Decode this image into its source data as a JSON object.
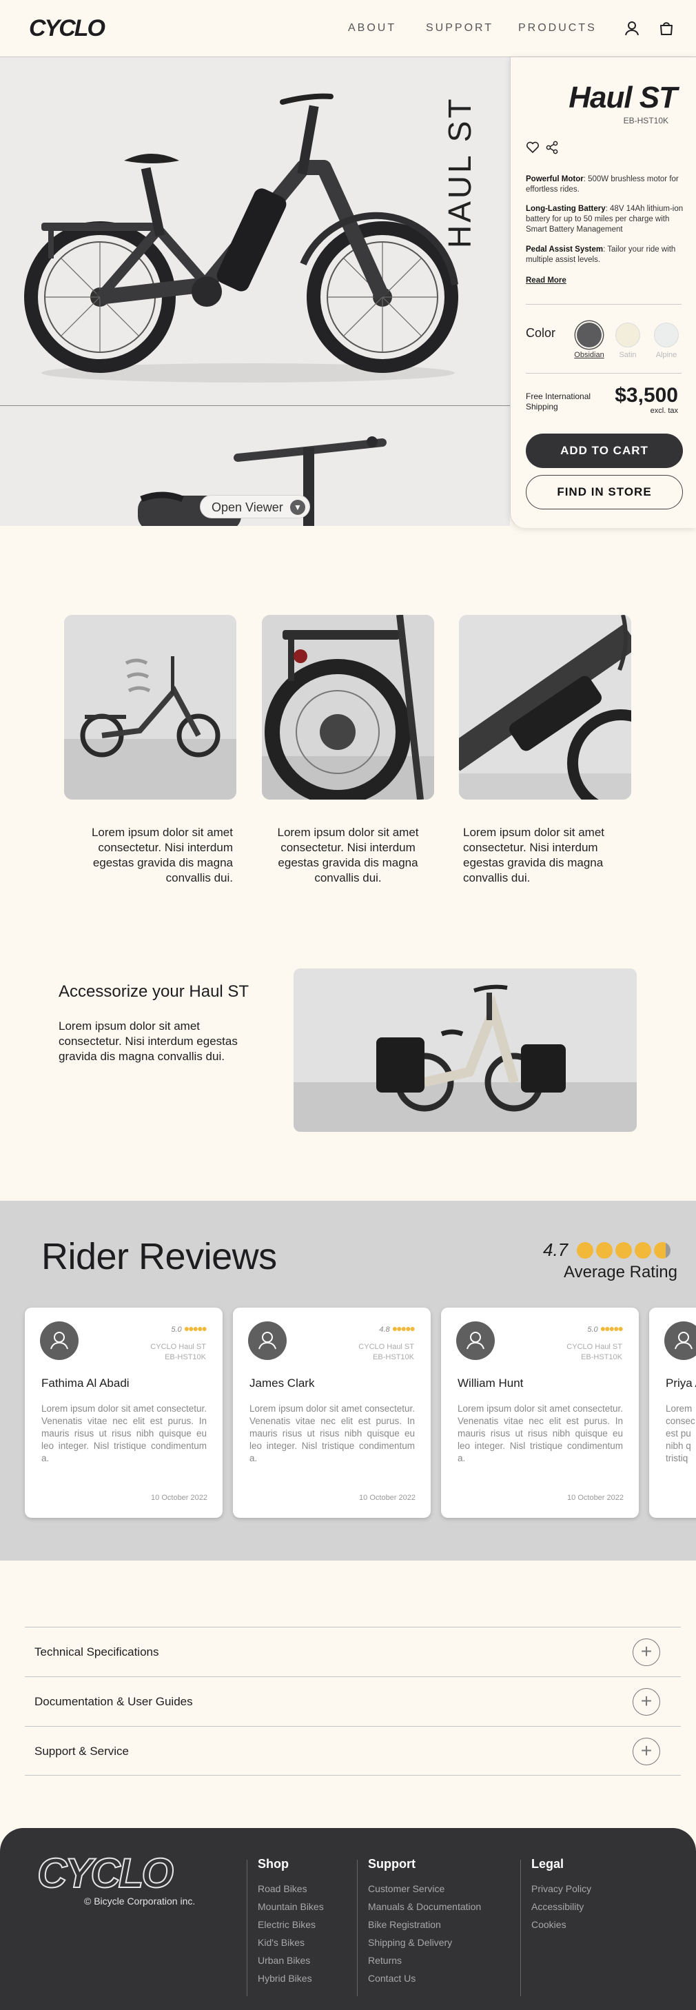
{
  "header": {
    "logo": "CYCLO",
    "nav": [
      "ABOUT",
      "SUPPORT",
      "PRODUCTS"
    ]
  },
  "hero": {
    "vertical_name": "HAUL ST",
    "viewer_label": "Open Viewer"
  },
  "product": {
    "title": "Haul ST",
    "model": "EB-HST10K",
    "features": [
      {
        "title": "Powerful Motor",
        "text": ": 500W brushless motor for effortless rides."
      },
      {
        "title": "Long-Lasting Battery",
        "text": ": 48V 14Ah lithium-ion battery for up to 50 miles per charge with Smart Battery Management"
      },
      {
        "title": "Pedal Assist System",
        "text": ": Tailor your ride with multiple assist levels."
      }
    ],
    "read_more": "Read More",
    "color_label": "Color",
    "colors": [
      {
        "name": "Obsidian",
        "hex": "#5b5b5d",
        "selected": true
      },
      {
        "name": "Satin",
        "hex": "#f3eddb",
        "selected": false
      },
      {
        "name": "Alpine",
        "hex": "#ebeeed",
        "selected": false
      }
    ],
    "shipping": "Free International Shipping",
    "price": "$3,500",
    "tax_note": "excl. tax",
    "add_to_cart": "ADD TO CART",
    "find_in_store": "FIND IN STORE"
  },
  "gallery": [
    {
      "caption": "Lorem ipsum dolor sit amet consectetur. Nisi interdum egestas gravida dis magna convallis dui.",
      "align": "right"
    },
    {
      "caption": "Lorem ipsum dolor sit amet consectetur. Nisi interdum egestas gravida dis magna convallis dui.",
      "align": "center"
    },
    {
      "caption": "Lorem ipsum dolor sit amet consectetur. Nisi interdum egestas gravida dis magna convallis dui.",
      "align": "left"
    }
  ],
  "accessorize": {
    "title": "Accessorize your Haul ST",
    "text": "Lorem ipsum dolor sit amet consectetur. Nisi interdum egestas gravida dis magna convallis dui."
  },
  "reviews": {
    "title": "Rider Reviews",
    "average": "4.7",
    "average_label": "Average Rating",
    "items": [
      {
        "name": "Fathima Al Abadi",
        "rating": "5.0",
        "stars": 5,
        "model_line1": "CYCLO Haul ST",
        "model_line2": "EB-HST10K",
        "text": "Lorem ipsum dolor sit amet consectetur. Venenatis vitae nec elit est purus. In mauris risus ut risus nibh quisque eu leo integer. Nisl tristique condimentum a.",
        "date": "10 October 2022"
      },
      {
        "name": "James Clark",
        "rating": "4.8",
        "stars": 5,
        "model_line1": "CYCLO Haul ST",
        "model_line2": "EB-HST10K",
        "text": "Lorem ipsum dolor sit amet consectetur. Venenatis vitae nec elit est purus. In mauris risus ut risus nibh quisque eu leo integer. Nisl tristique condimentum a.",
        "date": "10 October 2022"
      },
      {
        "name": "William Hunt",
        "rating": "5.0",
        "stars": 5,
        "model_line1": "CYCLO Haul ST",
        "model_line2": "EB-HST10K",
        "text": "Lorem ipsum dolor sit amet consectetur. Venenatis vitae nec elit est purus. In mauris risus ut risus nibh quisque eu leo integer. Nisl tristique condimentum a.",
        "date": "10 October 2022"
      },
      {
        "name": "Priya A",
        "rating": "",
        "stars": 0,
        "model_line1": "",
        "model_line2": "",
        "text": "Lorem consec est pu nibh q tristiq",
        "date": ""
      }
    ]
  },
  "accordion": [
    "Technical Specifications",
    "Documentation & User Guides",
    "Support & Service"
  ],
  "footer": {
    "logo": "CYCLO",
    "copyright": "© Bicycle Corporation inc.",
    "columns": [
      {
        "heading": "Shop",
        "links": [
          "Road Bikes",
          "Mountain Bikes",
          "Electric Bikes",
          "Kid's Bikes",
          "Urban Bikes",
          "Hybrid Bikes"
        ]
      },
      {
        "heading": "Support",
        "links": [
          "Customer Service",
          "Manuals & Documentation",
          "Bike Registration",
          "Shipping & Delivery",
          "Returns",
          "Contact Us"
        ]
      },
      {
        "heading": "Legal",
        "links": [
          "Privacy Policy",
          "Accessibility",
          "Cookies"
        ]
      }
    ]
  }
}
